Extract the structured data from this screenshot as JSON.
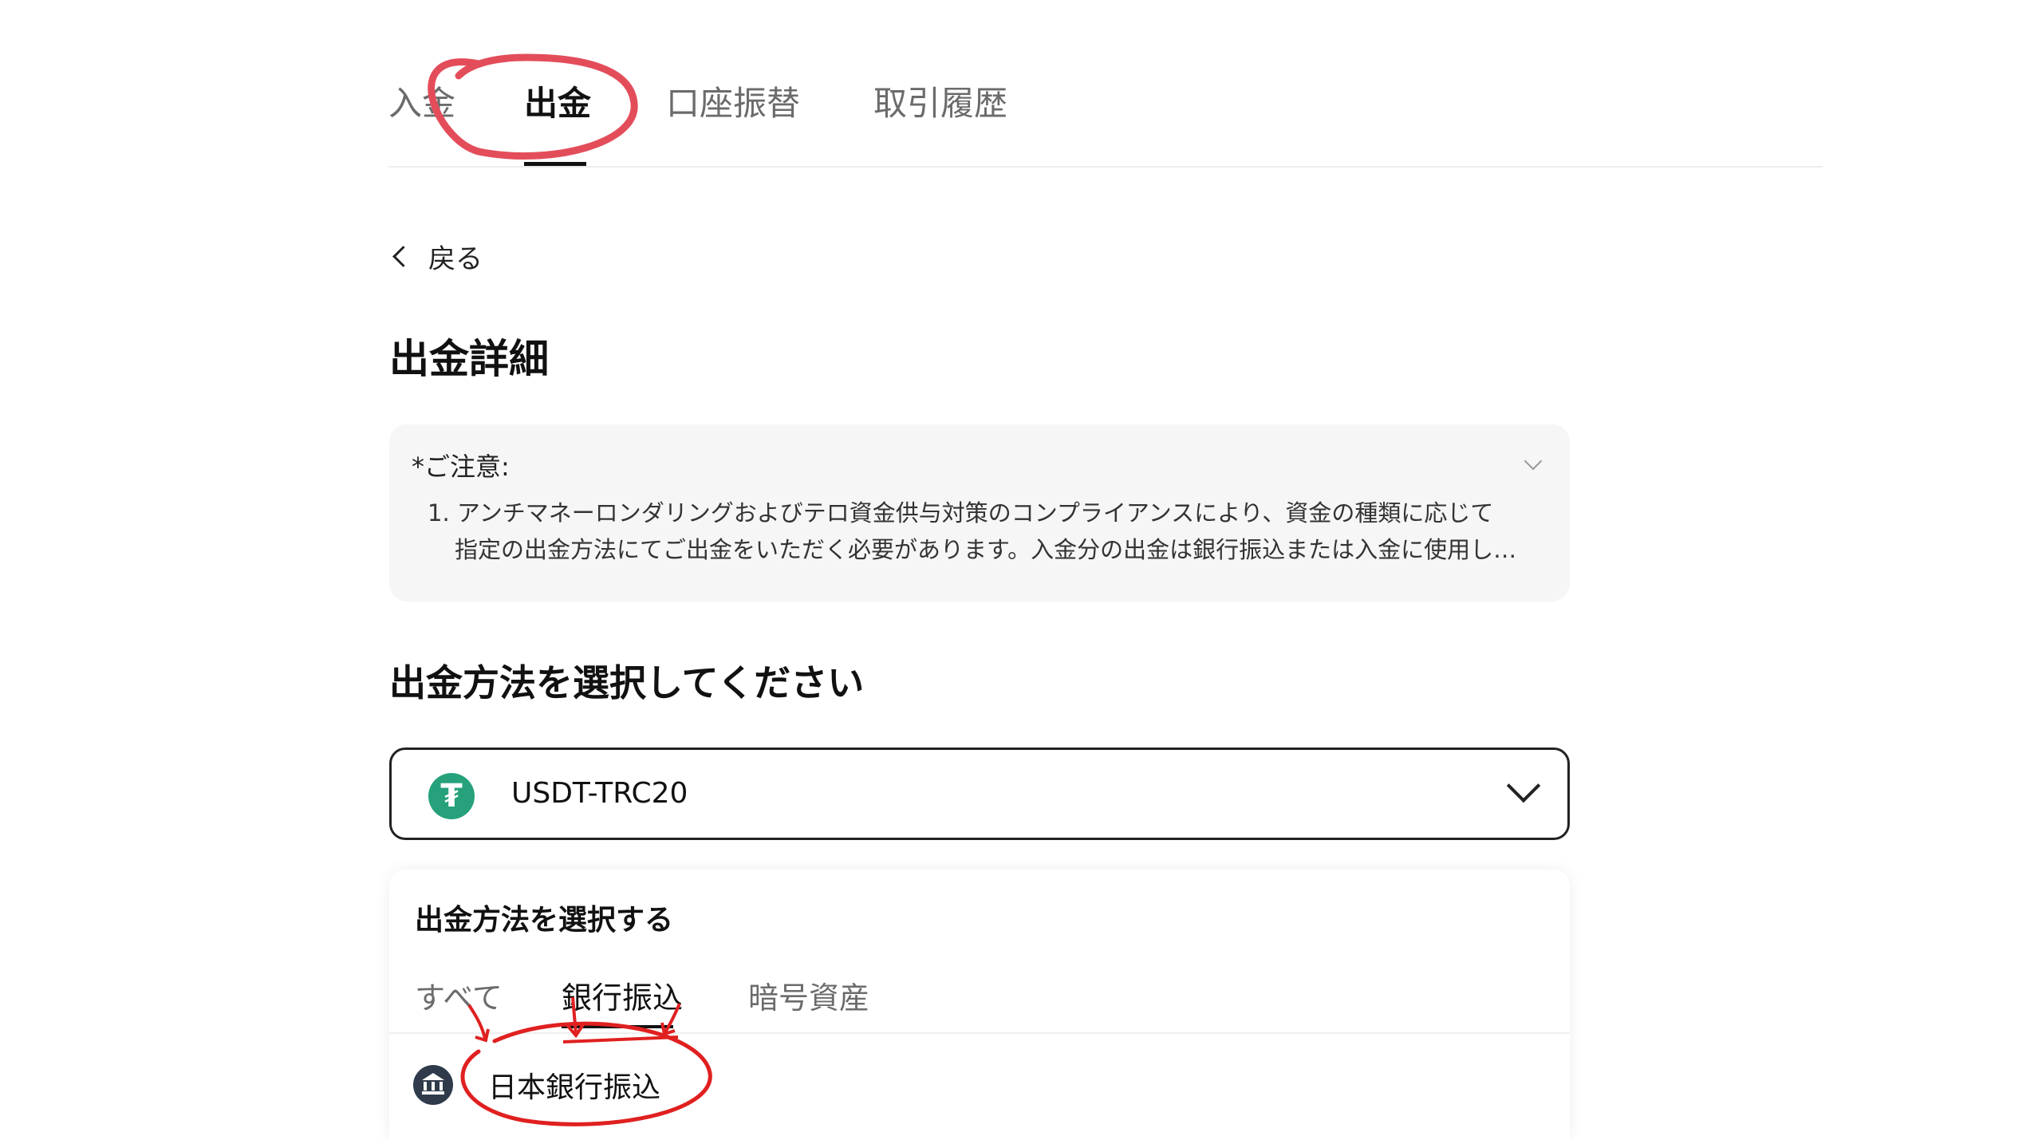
{
  "top_tabs": [
    {
      "label": "入金"
    },
    {
      "label": "出金"
    },
    {
      "label": "口座振替"
    },
    {
      "label": "取引履歴"
    }
  ],
  "active_top_tab": "出金",
  "back": {
    "label": "戻る"
  },
  "page_title": "出金詳細",
  "notice": {
    "title": "*ご注意:",
    "line1": "1. アンチマネーロンダリングおよびテロ資金供与対策のコンプライアンスにより、資金の種類に応じて",
    "line2": "指定の出金方法にてご出金をいただく必要があります。入金分の出金は銀行振込または入金に使用し…"
  },
  "section_title": "出金方法を選択してください",
  "currency_select": {
    "value": "USDT-TRC20",
    "icon": "tether-icon",
    "icon_glyph": "₮"
  },
  "method_panel": {
    "title": "出金方法を選択する",
    "tabs": [
      {
        "label": "すべて"
      },
      {
        "label": "銀行振込"
      },
      {
        "label": "暗号資産"
      }
    ],
    "active_tab": "銀行振込",
    "items": [
      {
        "label": "日本銀行振込",
        "icon": "bank-icon"
      }
    ]
  },
  "colors": {
    "accent_annotation": "#e02020",
    "tether_green": "#26a17b",
    "notice_bg": "#f6f6f6"
  }
}
